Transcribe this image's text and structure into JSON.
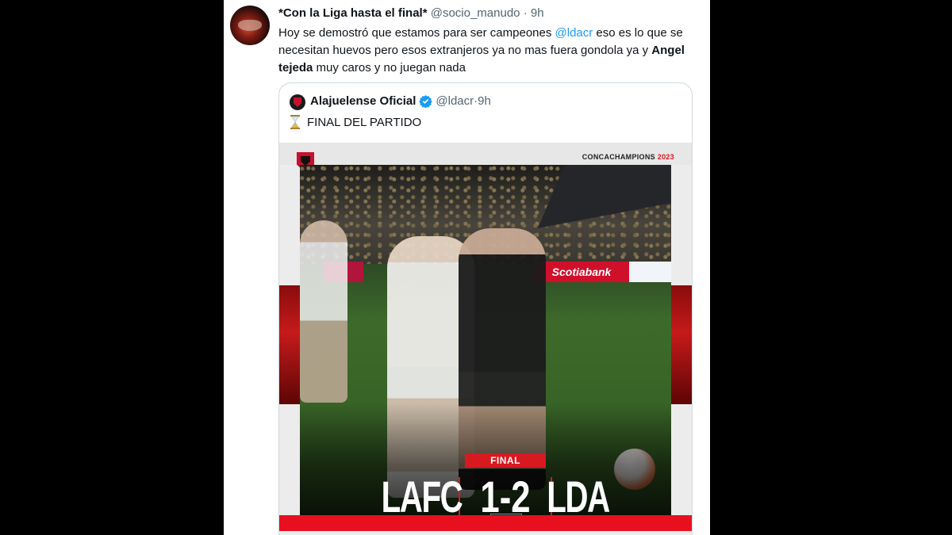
{
  "tweet": {
    "display_name": "*Con la Liga hasta el final*",
    "handle": "@socio_manudo",
    "separator": "·",
    "time": "9h",
    "text_part1": "Hoy se demostró que estamos para ser campeones ",
    "mention": "@ldacr",
    "text_part2": " eso es lo que se necesitan huevos pero esos extranjeros ya no mas fuera gondola ya y ",
    "bold_name": "Angel tejeda",
    "text_part3": " muy caros y no juegan nada"
  },
  "quoted_tweet": {
    "display_name": "Alajuelense Oficial",
    "verified": true,
    "handle": "@ldacr",
    "separator": "·",
    "time": "9h",
    "text": "FINAL DEL PARTIDO",
    "emoji_icon": "hourglass-icon"
  },
  "match_graphic": {
    "tournament": "CONCACHAMPIONS",
    "year": "2023",
    "status": "FINAL",
    "home_team": "LAFC",
    "away_team": "LDA",
    "score": "1-2",
    "board_text": "Scotiabank",
    "colors": {
      "accent_red": "#d71920",
      "mention_blue": "#1d9bf0"
    }
  }
}
